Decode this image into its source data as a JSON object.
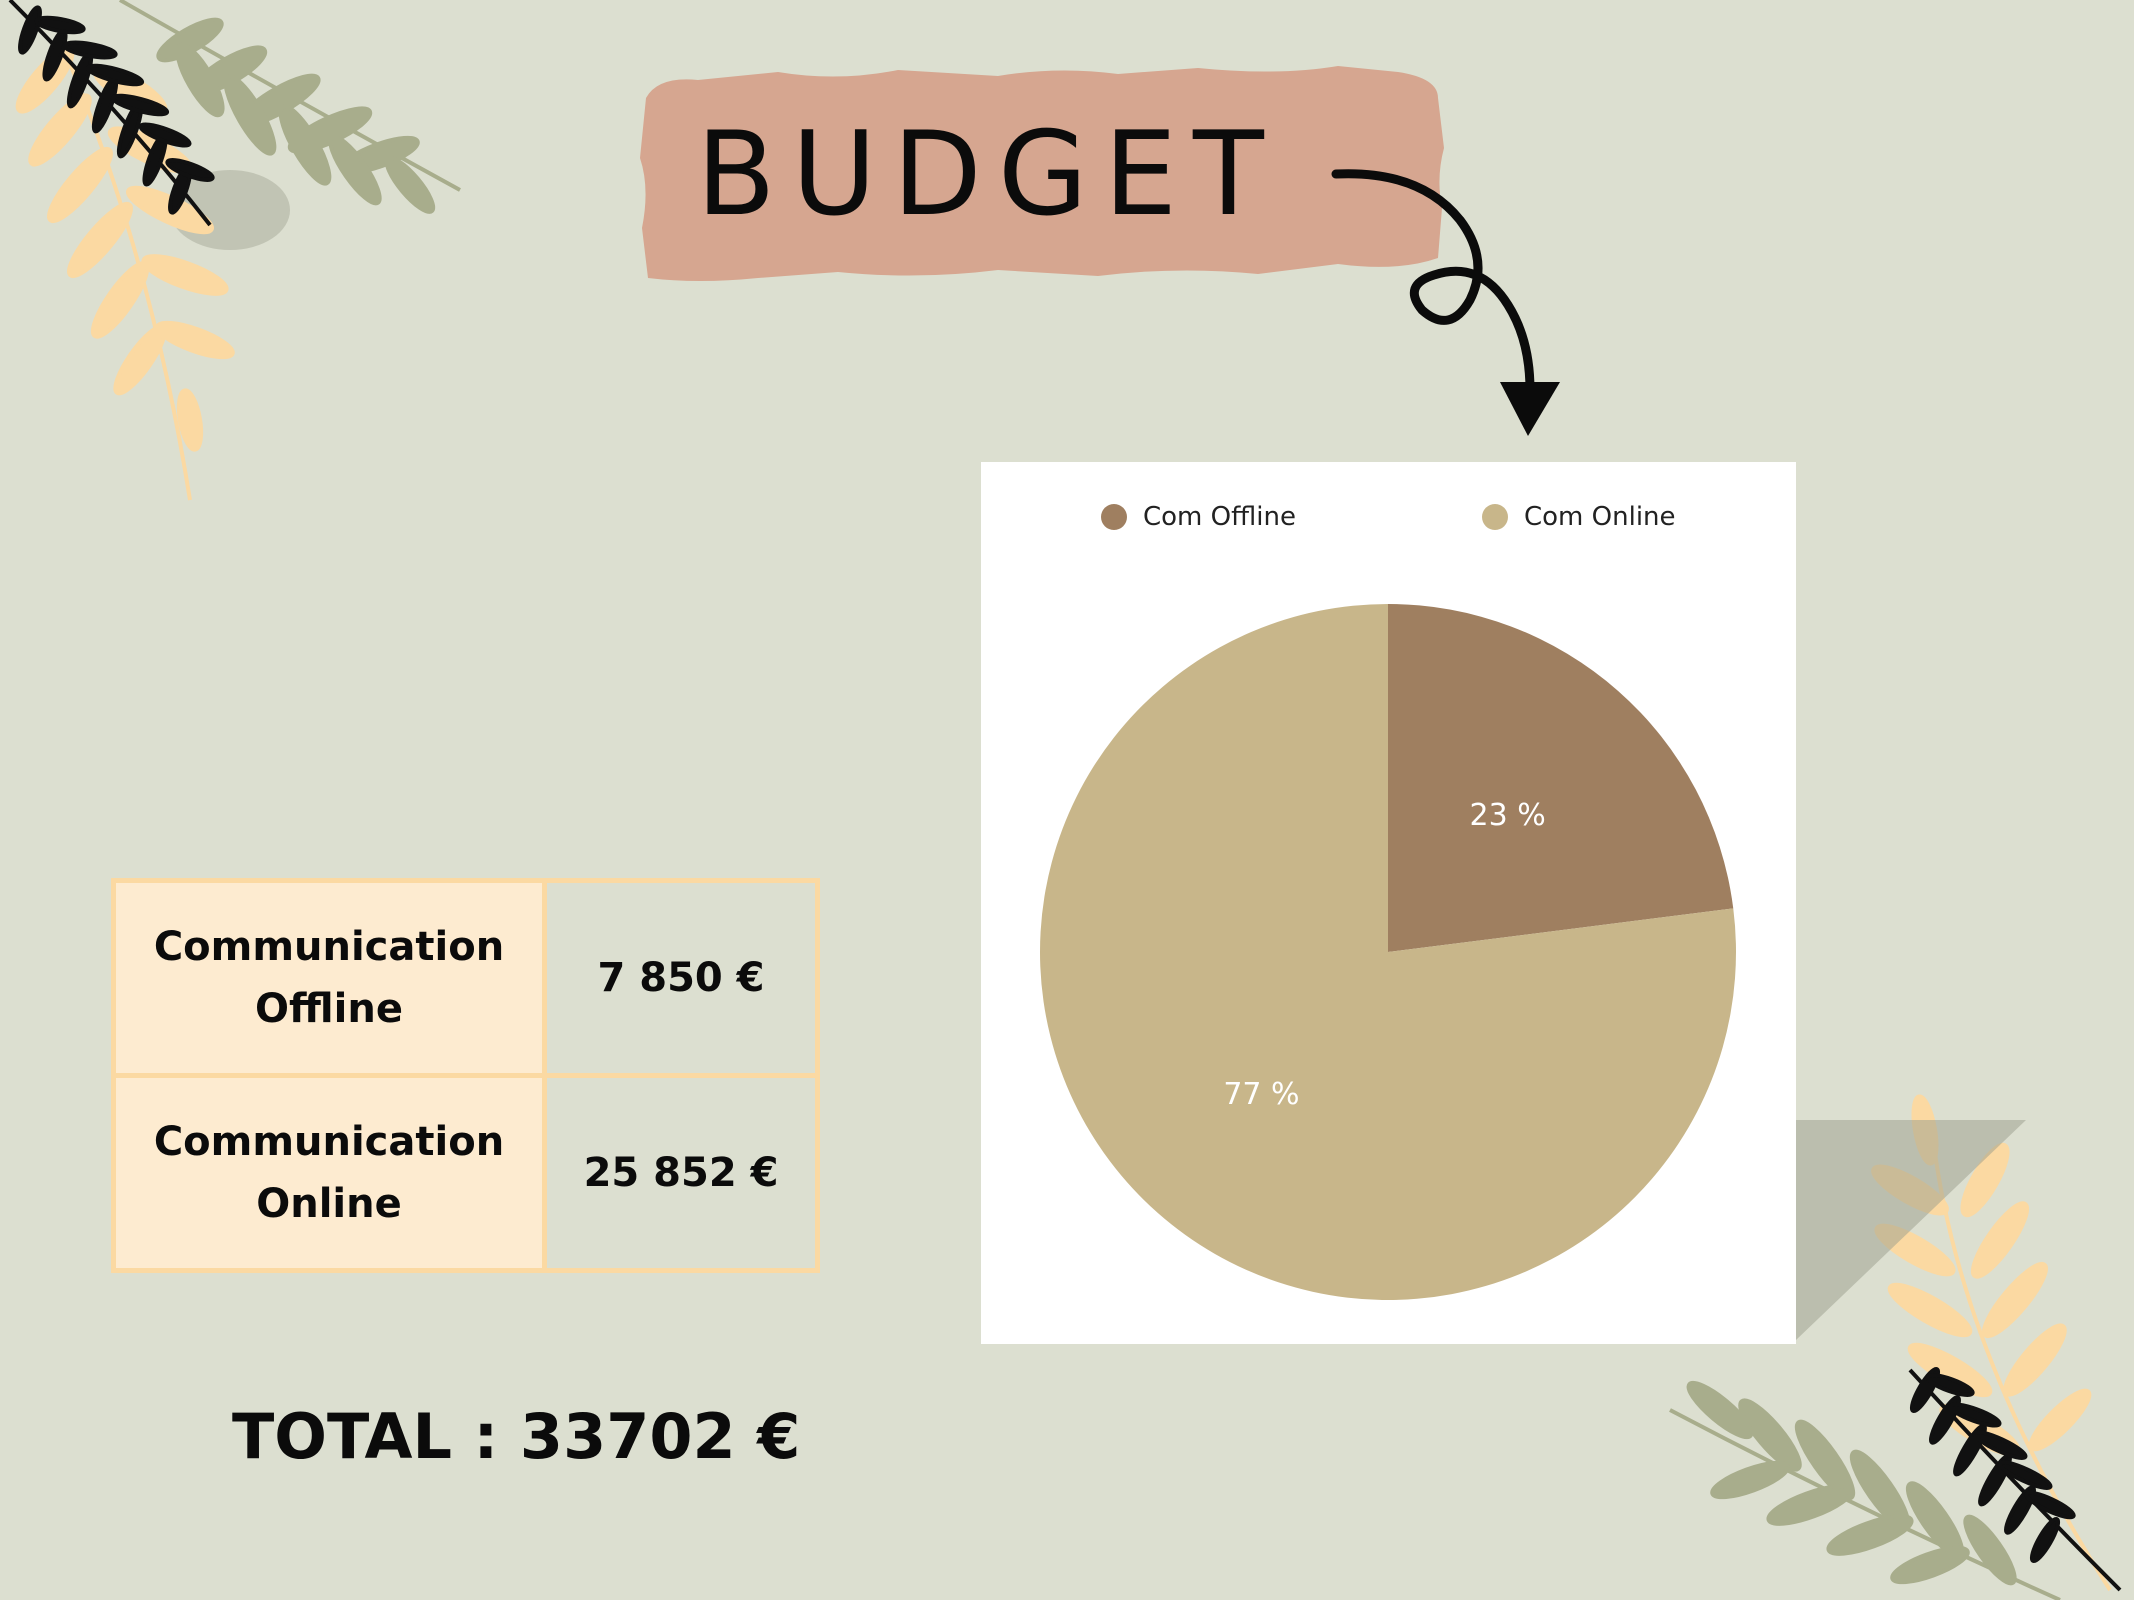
{
  "title": "BUDGET",
  "colors": {
    "background": "#dcdfd0",
    "banner": "#d6a690",
    "offline": "#9f7f60",
    "online": "#c8b68a",
    "table_border": "#fbd9a2",
    "table_label_bg": "#fdebd0"
  },
  "table": {
    "rows": [
      {
        "label_line1": "Communication",
        "label_line2": "Offline",
        "value": "7 850 €"
      },
      {
        "label_line1": "Communication",
        "label_line2": "Online",
        "value": "25 852 €"
      }
    ]
  },
  "total": "TOTAL : 33702 €",
  "chart_data": {
    "type": "pie",
    "legend_position": "top",
    "series": [
      {
        "name": "Com Offline",
        "value": 23,
        "label": "23 %",
        "color": "#9f7f60"
      },
      {
        "name": "Com Online",
        "value": 77,
        "label": "77 %",
        "color": "#c8b68a"
      }
    ]
  },
  "icons": [
    "palm-leaf-icon",
    "curly-arrow-icon"
  ]
}
